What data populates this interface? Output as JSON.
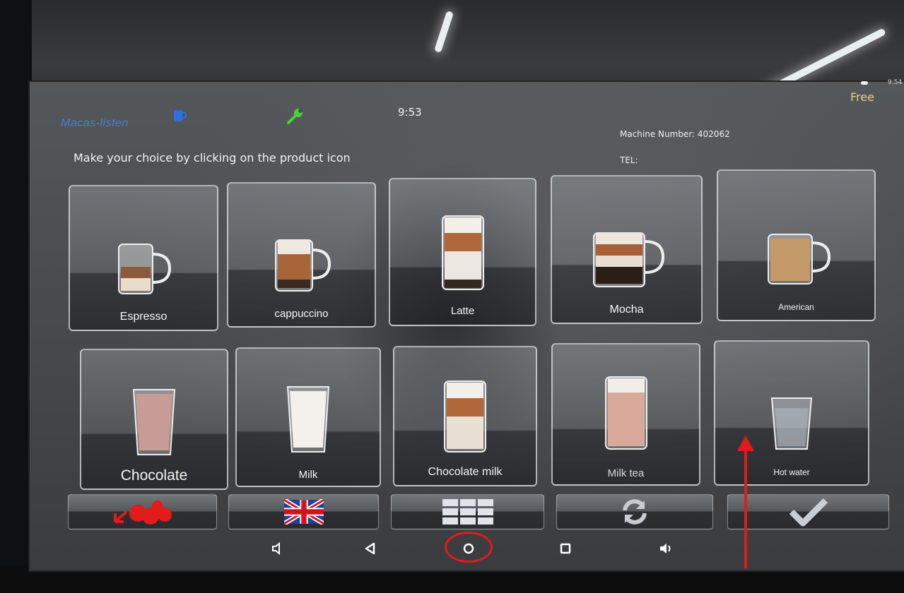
{
  "status_bar": {
    "brand": "Macas-listen",
    "clock": "9:53",
    "free_label": "Free",
    "system_time": "9:54"
  },
  "info": {
    "machine_number": "Machine Number: 402062",
    "tel": "TEL:"
  },
  "instruction": "Make your choice by clicking on the product icon",
  "products": [
    {
      "label": "Espresso",
      "icon": "espresso-cup-icon"
    },
    {
      "label": "cappuccino",
      "icon": "cappuccino-cup-icon"
    },
    {
      "label": "Latte",
      "icon": "latte-glass-icon"
    },
    {
      "label": "Mocha",
      "icon": "mocha-cup-icon"
    },
    {
      "label": "American",
      "icon": "americano-cup-icon"
    },
    {
      "label": "Chocolate",
      "icon": "chocolate-glass-icon"
    },
    {
      "label": "Milk",
      "icon": "milk-glass-icon"
    },
    {
      "label": "Chocolate milk",
      "icon": "chocolate-milk-glass-icon"
    },
    {
      "label": "Milk tea",
      "icon": "milk-tea-glass-icon"
    },
    {
      "label": "Hot water",
      "icon": "hot-water-glass-icon"
    }
  ],
  "bottom_buttons": [
    {
      "name": "coins-button",
      "icon": "coins-icon"
    },
    {
      "name": "language-button",
      "icon": "uk-flag-icon"
    },
    {
      "name": "menu-grid-button",
      "icon": "grid-icon"
    },
    {
      "name": "refresh-button",
      "icon": "refresh-icon"
    },
    {
      "name": "confirm-button",
      "icon": "checkmark-icon"
    }
  ],
  "nav_bar": [
    "volume-down-icon",
    "back-icon",
    "home-icon",
    "recents-icon",
    "volume-up-icon"
  ],
  "colors": {
    "free_text": "#e9cf84",
    "brand_blue": "#4a7fd0",
    "highlight_red": "#e21b1b"
  }
}
